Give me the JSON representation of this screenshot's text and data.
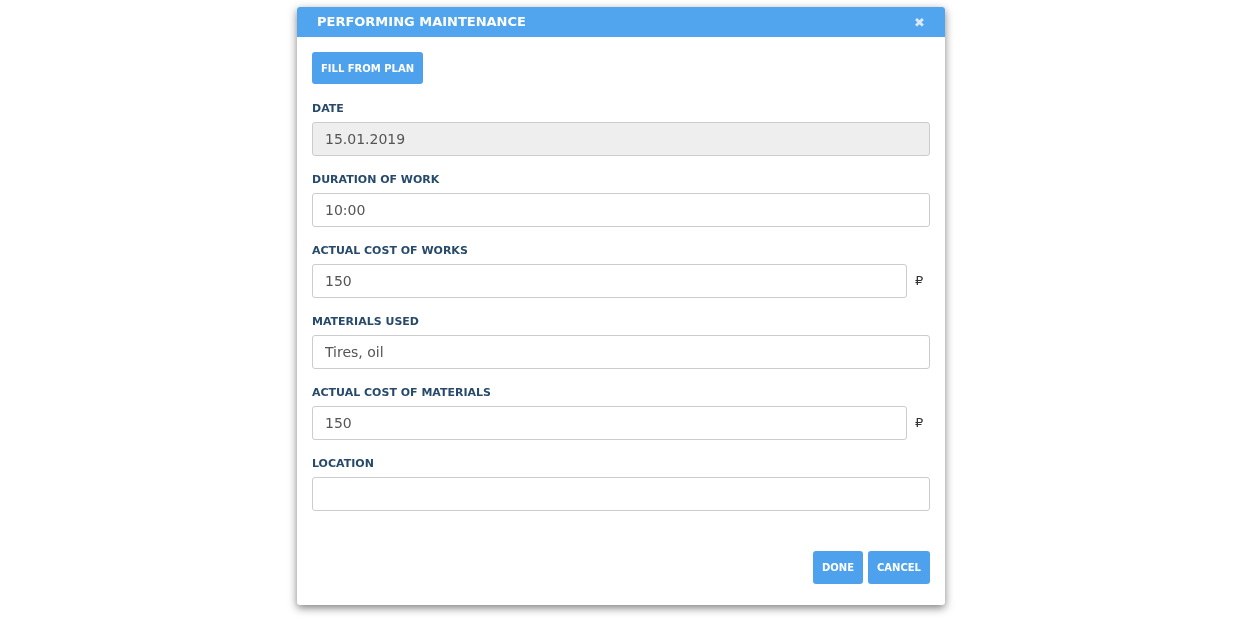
{
  "dialog": {
    "title": "PERFORMING MAINTENANCE",
    "close": "✖"
  },
  "fill_button": "FILL FROM PLAN",
  "fields": [
    {
      "label": "DATE",
      "value": "15.01.2019",
      "disabled": true
    },
    {
      "label": "DURATION OF WORK",
      "value": "10:00",
      "disabled": false
    },
    {
      "label": "ACTUAL COST OF WORKS",
      "value": "150",
      "disabled": false,
      "suffix": "₽"
    },
    {
      "label": "MATERIALS USED",
      "value": "Tires, oil",
      "disabled": false
    },
    {
      "label": "ACTUAL COST OF MATERIALS",
      "value": "150",
      "disabled": false,
      "suffix": "₽"
    },
    {
      "label": "LOCATION",
      "disabled": false
    }
  ],
  "buttons": [
    "DONE",
    "CANCEL"
  ]
}
